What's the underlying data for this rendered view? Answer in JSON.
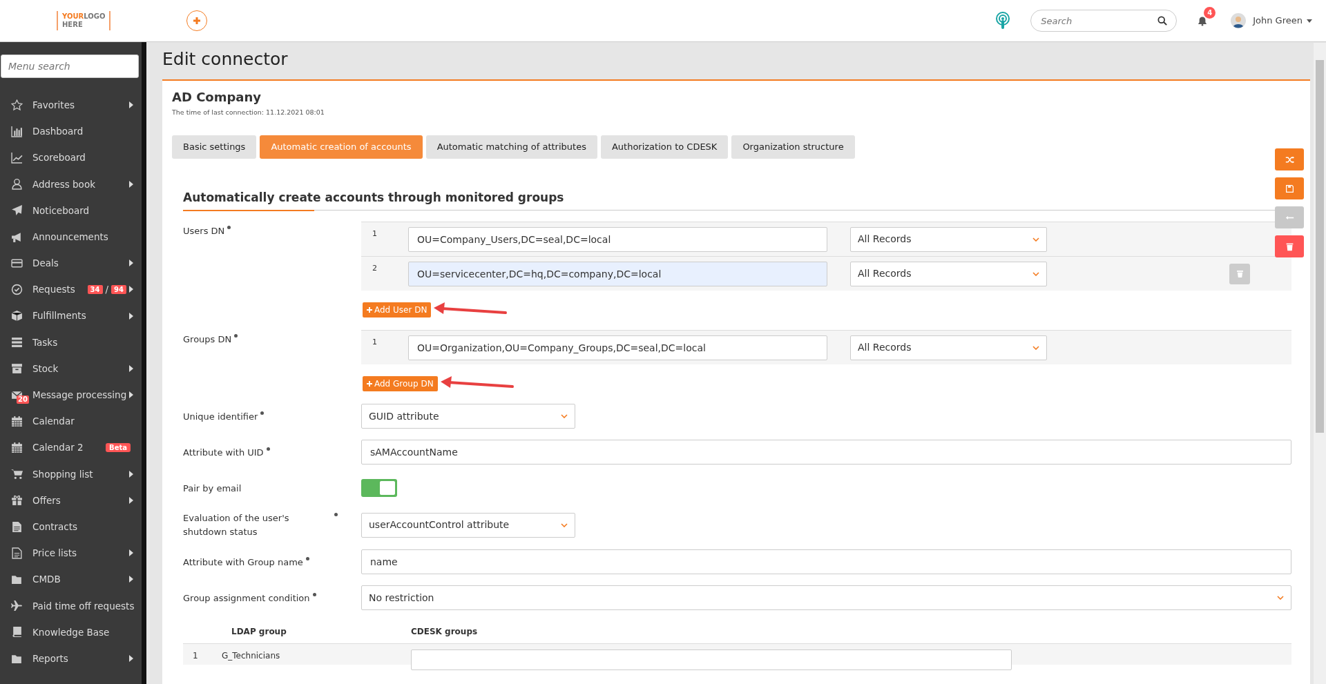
{
  "header": {
    "logo": {
      "top_left": "YOUR",
      "top_right": "LOGO",
      "bottom": "HERE"
    },
    "search": {
      "placeholder": "Search"
    },
    "notifications": "4",
    "user": "John Green"
  },
  "sidebar": {
    "search": {
      "placeholder": "Menu search"
    },
    "items": [
      {
        "label": "Favorites",
        "submenu": true
      },
      {
        "label": "Dashboard",
        "submenu": false
      },
      {
        "label": "Scoreboard",
        "submenu": false
      },
      {
        "label": "Address book",
        "submenu": true
      },
      {
        "label": "Noticeboard",
        "submenu": false
      },
      {
        "label": "Announcements",
        "submenu": false
      },
      {
        "label": "Deals",
        "submenu": true
      },
      {
        "label": "Requests",
        "submenu": true,
        "badges": [
          "34",
          "/",
          "94"
        ]
      },
      {
        "label": "Fulfillments",
        "submenu": true
      },
      {
        "label": "Tasks",
        "submenu": false
      },
      {
        "label": "Stock",
        "submenu": true
      },
      {
        "label": "Message processing",
        "submenu": true,
        "icon_badge": "20"
      },
      {
        "label": "Calendar",
        "submenu": false
      },
      {
        "label": "Calendar 2",
        "submenu": false,
        "tag": "Beta"
      },
      {
        "label": "Shopping list",
        "submenu": true
      },
      {
        "label": "Offers",
        "submenu": true
      },
      {
        "label": "Contracts",
        "submenu": false
      },
      {
        "label": "Price lists",
        "submenu": true
      },
      {
        "label": "CMDB",
        "submenu": true
      },
      {
        "label": "Paid time off requests",
        "submenu": false
      },
      {
        "label": "Knowledge Base",
        "submenu": false
      },
      {
        "label": "Reports",
        "submenu": true
      }
    ]
  },
  "page_title": "Edit connector",
  "connector": {
    "name": "AD Company",
    "last_connection": "The time of last connection: 11.12.2021 08:01"
  },
  "tabs": [
    {
      "label": "Basic settings",
      "selected": false
    },
    {
      "label": "Automatic creation of accounts",
      "selected": true
    },
    {
      "label": "Automatic matching of attributes",
      "selected": false
    },
    {
      "label": "Authorization to CDESK",
      "selected": false
    },
    {
      "label": "Organization structure",
      "selected": false
    }
  ],
  "section_title": "Automatically create accounts through monitored groups",
  "dn_groups": [
    {
      "label": "Users DN",
      "required": true,
      "add_button": "Add User DN",
      "rows": [
        {
          "number": "1",
          "value": "OU=Company_Users,DC=seal,DC=local",
          "filter": "All Records",
          "autofilled": false,
          "deletable": false
        },
        {
          "number": "2",
          "value": "OU=servicecenter,DC=hq,DC=company,DC=local",
          "filter": "All Records",
          "autofilled": true,
          "deletable": true
        }
      ]
    },
    {
      "label": "Groups DN",
      "required": true,
      "add_button": "Add Group DN",
      "rows": [
        {
          "number": "1",
          "value": "OU=Organization,OU=Company_Groups,DC=seal,DC=local",
          "filter": "All Records",
          "autofilled": false,
          "deletable": false
        }
      ]
    }
  ],
  "fields": [
    {
      "kind": "select",
      "label": "Unique identifier",
      "required": true,
      "value": "GUID attribute"
    },
    {
      "kind": "text",
      "label": "Attribute with UID",
      "required": true,
      "value": "sAMAccountName"
    },
    {
      "kind": "toggle",
      "label": "Pair by email",
      "required": false,
      "on": true
    },
    {
      "kind": "select",
      "label": "Evaluation of the user's shutdown status",
      "required": true,
      "value": "userAccountControl attribute"
    },
    {
      "kind": "text",
      "label": "Attribute with Group name",
      "required": true,
      "value": "name"
    },
    {
      "kind": "select",
      "label": "Group assignment condition",
      "required": true,
      "value": "No restriction"
    }
  ],
  "group_table": {
    "columns": [
      "LDAP group",
      "CDESK groups"
    ],
    "rows": [
      {
        "number": "1",
        "ldap_group": "G_Technicians"
      }
    ]
  }
}
